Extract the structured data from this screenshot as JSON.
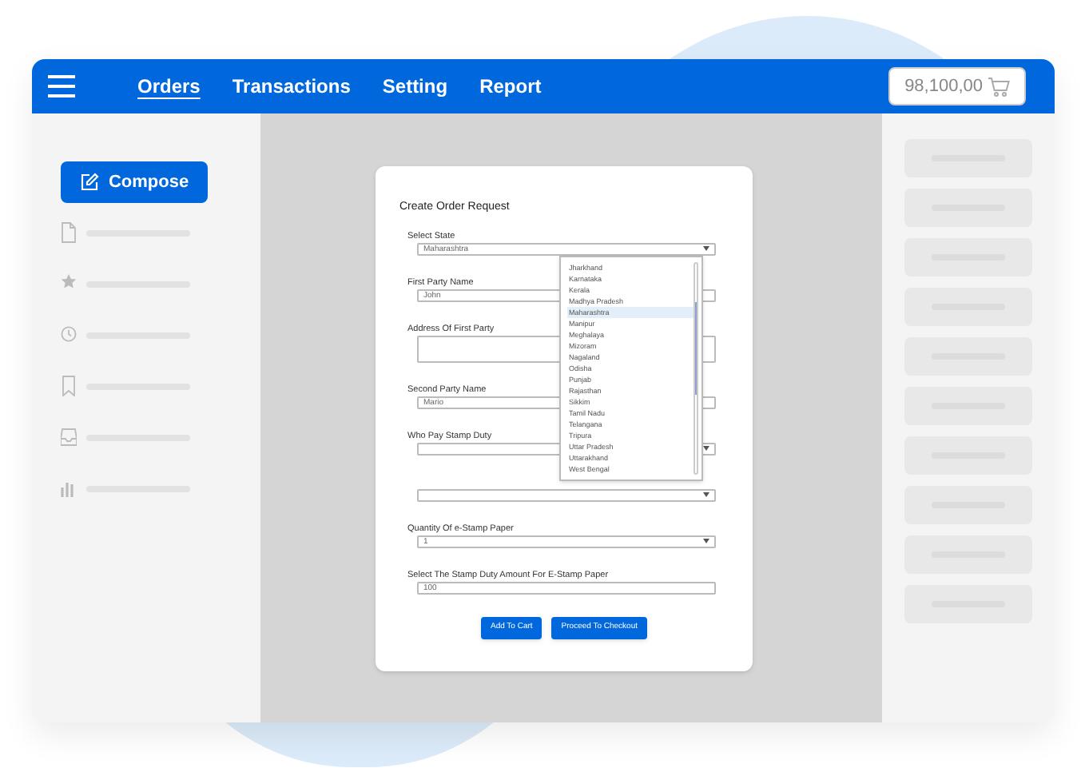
{
  "header": {
    "tabs": [
      {
        "label": "Orders",
        "selected": true
      },
      {
        "label": "Transactions",
        "selected": false
      },
      {
        "label": "Setting",
        "selected": false
      },
      {
        "label": "Report",
        "selected": false
      }
    ],
    "balance": "98,100,00"
  },
  "sidebar": {
    "compose": "Compose"
  },
  "form": {
    "title": "Create Order Request",
    "fields": [
      {
        "kind": "select",
        "label": "Select State",
        "value": "Maharashtra"
      },
      {
        "kind": "input",
        "label": "First Party Name",
        "value": "John"
      },
      {
        "kind": "textarea",
        "label": "Address Of First Party"
      },
      {
        "kind": "input",
        "label": "Second Party Name",
        "value": "Mario"
      },
      {
        "kind": "select",
        "label": "Who Pay Stamp Duty"
      },
      {
        "kind": "select"
      },
      {
        "kind": "select",
        "label": "Quantity Of e-Stamp Paper",
        "value": "1"
      },
      {
        "kind": "input",
        "label": "Select The Stamp Duty Amount For E-Stamp Paper",
        "value": "100"
      }
    ],
    "buttons": [
      "Add To Cart",
      "Proceed To Checkout"
    ],
    "dropdown": [
      {
        "label": "Jharkhand",
        "selected": false
      },
      {
        "label": "Karnataka",
        "selected": false
      },
      {
        "label": "Kerala",
        "selected": false
      },
      {
        "label": "Madhya Pradesh",
        "selected": false
      },
      {
        "label": "Maharashtra",
        "selected": true
      },
      {
        "label": "Manipur",
        "selected": false
      },
      {
        "label": "Meghalaya",
        "selected": false
      },
      {
        "label": "Mizoram",
        "selected": false
      },
      {
        "label": "Nagaland",
        "selected": false
      },
      {
        "label": "Odisha",
        "selected": false
      },
      {
        "label": "Punjab",
        "selected": false
      },
      {
        "label": "Rajasthan",
        "selected": false
      },
      {
        "label": "Sikkim",
        "selected": false
      },
      {
        "label": "Tamil Nadu",
        "selected": false
      },
      {
        "label": "Telangana",
        "selected": false
      },
      {
        "label": "Tripura",
        "selected": false
      },
      {
        "label": "Uttar Pradesh",
        "selected": false
      },
      {
        "label": "Uttarakhand",
        "selected": false
      },
      {
        "label": "West Bengal",
        "selected": false
      }
    ]
  }
}
